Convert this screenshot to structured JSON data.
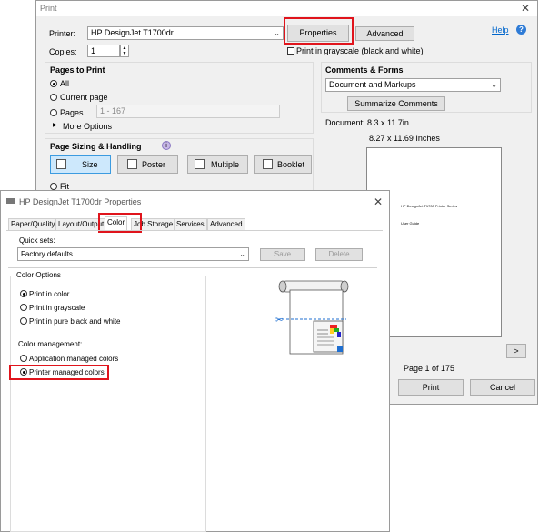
{
  "print_dialog": {
    "title": "Print",
    "close": "✕",
    "printer_label": "Printer:",
    "printer_value": "HP DesignJet T1700dr",
    "properties_button": "Properties",
    "advanced_button": "Advanced",
    "help_link": "Help",
    "help_icon": "?",
    "copies_label": "Copies:",
    "copies_value": "1",
    "grayscale_label": "Print in grayscale (black and white)",
    "pages_to_print": {
      "heading": "Pages to Print",
      "all": "All",
      "current_page": "Current page",
      "pages": "Pages",
      "pages_value": "1 - 167",
      "more_options": "More Options"
    },
    "page_sizing": {
      "heading": "Page Sizing & Handling",
      "info_icon": "i",
      "size": "Size",
      "poster": "Poster",
      "multiple": "Multiple",
      "booklet": "Booklet",
      "fit": "Fit"
    },
    "comments_forms": {
      "heading": "Comments & Forms",
      "value": "Document and Markups",
      "summarize_button": "Summarize Comments"
    },
    "document_size": "Document: 8.3 x 11.7in",
    "preview_size": "8.27 x 11.69 Inches",
    "preview_text_1": "HP DesignJet T1700 Printer Series",
    "preview_text_2": "User Guide",
    "next_page_button": ">",
    "page_indicator": "Page 1 of 175",
    "print_button": "Print",
    "cancel_button": "Cancel"
  },
  "properties_dialog": {
    "title": "HP DesignJet T1700dr Properties",
    "close": "✕",
    "tabs": [
      "Paper/Quality",
      "Layout/Output",
      "Color",
      "Job Storage",
      "Services",
      "Advanced"
    ],
    "quick_sets_label": "Quick sets:",
    "quick_sets_value": "Factory defaults",
    "save_button": "Save",
    "delete_button": "Delete",
    "color_options": {
      "group": "Color Options",
      "print_in_color": "Print in color",
      "print_in_grayscale": "Print in grayscale",
      "print_black_white": "Print in pure black and white",
      "color_management": "Color management:",
      "application_managed": "Application managed colors",
      "printer_managed": "Printer managed colors"
    }
  },
  "colors": {
    "highlight_red": "#e0141c",
    "selected_blue": "#cde8fc",
    "link_blue": "#0066cc"
  }
}
